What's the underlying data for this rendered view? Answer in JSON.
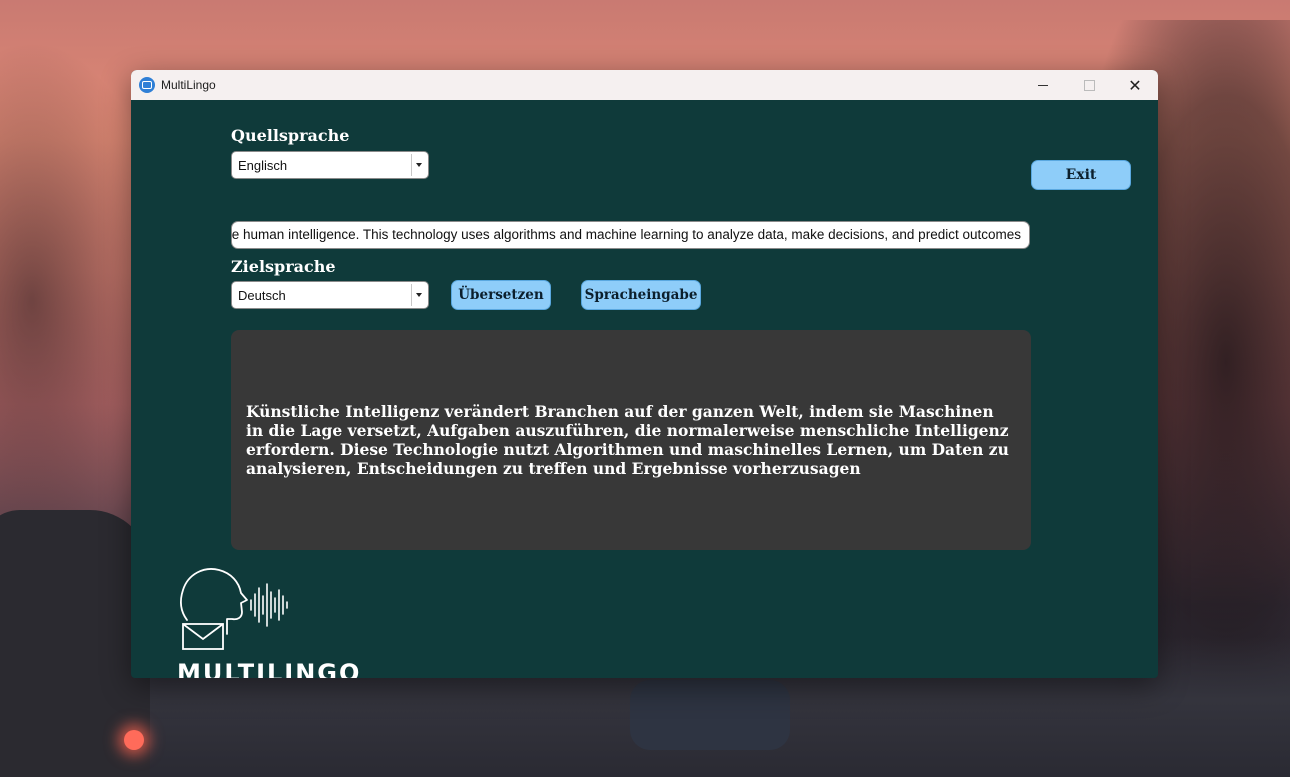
{
  "window": {
    "title": "MultiLingo"
  },
  "source": {
    "label": "Quellsprache",
    "selected": "Englisch"
  },
  "input": {
    "value": "Artificial intelligence is transforming industries around the world by enabling machines to perform tasks that normally require human intelligence. This technology uses algorithms and machine learning to analyze data, make decisions, and predict outcomes"
  },
  "target": {
    "label": "Zielsprache",
    "selected": "Deutsch"
  },
  "buttons": {
    "exit": "Exit",
    "translate": "Übersetzen",
    "voice": "Spracheingabe"
  },
  "output": {
    "text": "Künstliche Intelligenz verändert Branchen auf der ganzen Welt, indem sie Maschinen in die Lage versetzt, Aufgaben auszuführen, die normalerweise menschliche Intelligenz erfordern. Diese Technologie nutzt Algorithmen und maschinelles Lernen, um Daten zu analysieren, Entscheidungen zu treffen und Ergebnisse vorherzusagen"
  },
  "logo": {
    "wordmark": "MULTILINGO"
  },
  "icons": {
    "app": "translate-icon",
    "logo": "speaking-head-mail-icon"
  },
  "colors": {
    "window_bg": "#0f3a3a",
    "button_bg": "#8ecdf9",
    "output_bg": "#383838"
  }
}
